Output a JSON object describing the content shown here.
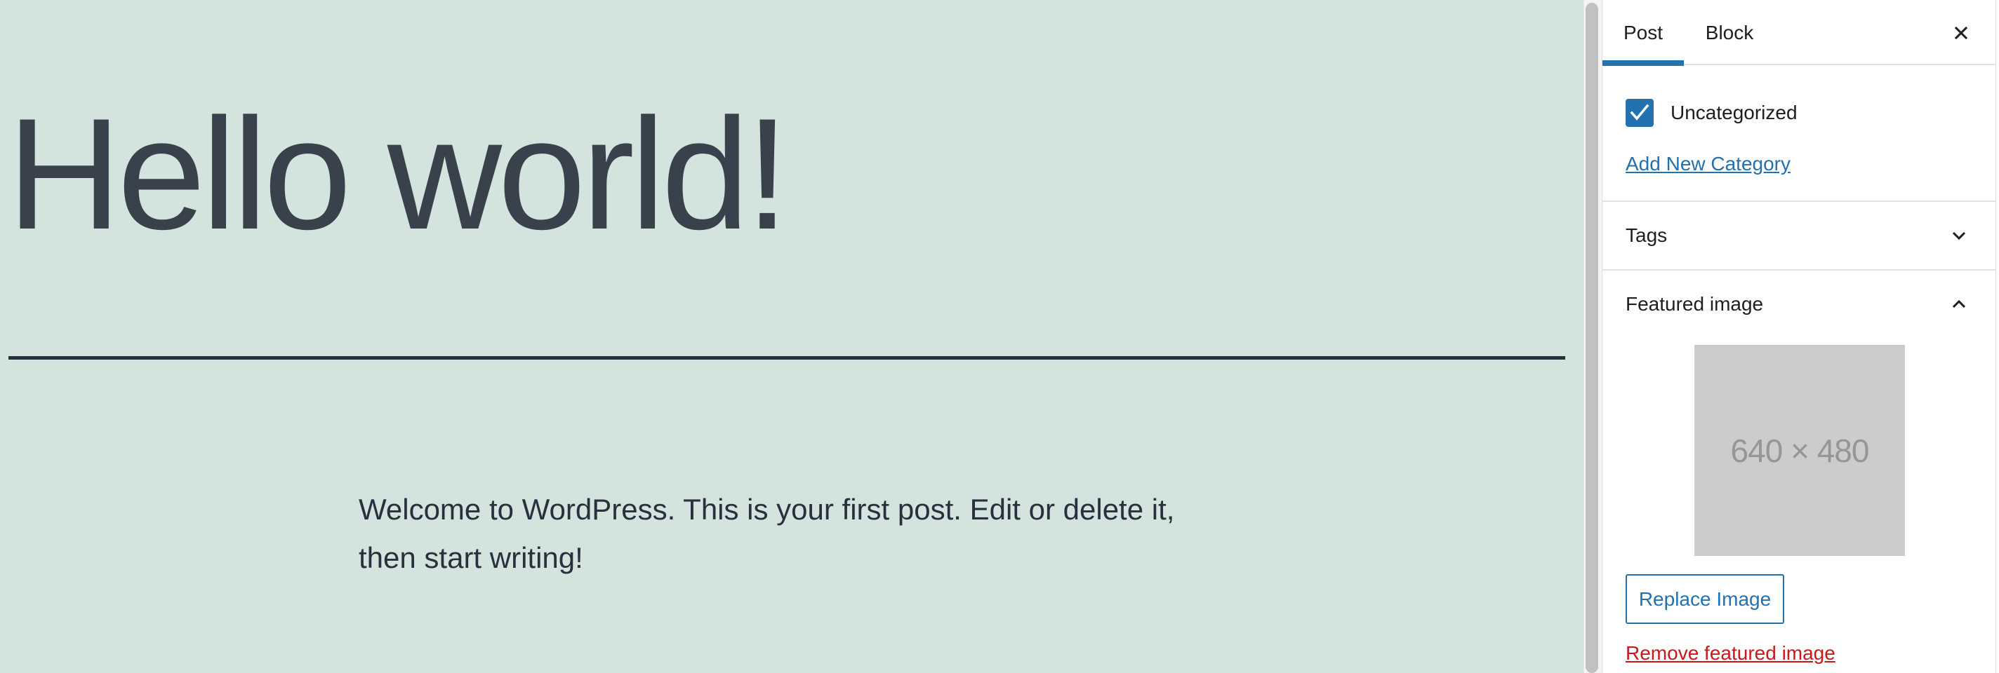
{
  "canvas": {
    "background": "#d3e3de",
    "title": "Hello world!",
    "paragraph": "Welcome to WordPress. This is your first post. Edit or delete it, then start writing!"
  },
  "sidebar": {
    "tabs": [
      {
        "label": "Post",
        "active": true
      },
      {
        "label": "Block",
        "active": false
      }
    ],
    "close_icon": "close-icon",
    "categories": {
      "items": [
        {
          "label": "Uncategorized",
          "checked": true
        }
      ],
      "add_new_label": "Add New Category"
    },
    "tags_panel": {
      "title": "Tags",
      "expanded": false,
      "icon": "chevron-down-icon"
    },
    "featured_image_panel": {
      "title": "Featured image",
      "expanded": true,
      "icon": "chevron-up-icon",
      "placeholder_text": "640 × 480",
      "replace_label": "Replace Image",
      "remove_label": "Remove featured image"
    }
  },
  "colors": {
    "accent": "#2271b1",
    "danger": "#cc1818",
    "canvas_text": "#39414d"
  }
}
